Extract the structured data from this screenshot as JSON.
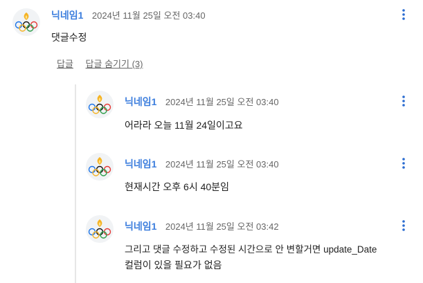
{
  "comment": {
    "nickname": "닉네임1",
    "timestamp": "2024년 11월 25일 오전 03:40",
    "text": "댓글수정",
    "reply_label": "답글",
    "hide_replies_label": "답글 숨기기 (3)"
  },
  "replies": [
    {
      "nickname": "닉네임1",
      "timestamp": "2024년 11월 25일 오전 03:40",
      "lines": [
        "어라라 오늘 11월 24일이고요"
      ]
    },
    {
      "nickname": "닉네임1",
      "timestamp": "2024년 11월 25일 오전 03:40",
      "lines": [
        "현재시간 오후 6시 40분임"
      ]
    },
    {
      "nickname": "닉네임1",
      "timestamp": "2024년 11월 25일 오전 03:42",
      "lines": [
        "그리고 댓글 수정하고 수정된 시간으로 안 변할거면 update_Date",
        "컬럼이 있을 필요가 없음"
      ]
    }
  ],
  "icons": {
    "avatar": "olympic-rings-with-flame-avatar",
    "more": "vertical-more-dots-icon"
  },
  "colors": {
    "nickname": "#3b7ddd",
    "more_icon": "#2b6cd1"
  }
}
